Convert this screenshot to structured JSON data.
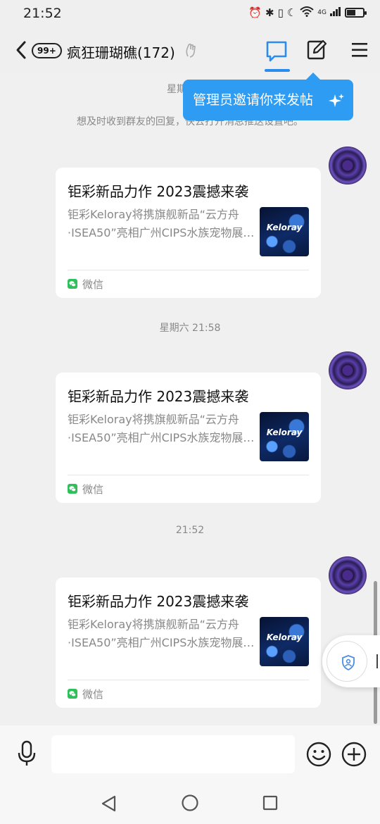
{
  "status_bar": {
    "time": "21:52",
    "network": "4G"
  },
  "header": {
    "unread_count": "99+",
    "group_title": "疯狂珊瑚礁(172)"
  },
  "tooltip": {
    "text": "管理员邀请你来发帖"
  },
  "system": {
    "note_start": "想及时收到群友的回复，快去打开消息推送设置吧。",
    "time1": "星期五",
    "time2": "星期六 21:58",
    "time3": "21:52"
  },
  "messages": [
    {
      "title": "钜彩新品力作 2023震撼来袭",
      "description": "钜彩Keloray将携旗舰新品“云方舟·ISEA50”亮相广州CIPS水族宠物展…",
      "thumb_label": "Keloray",
      "source": "微信"
    },
    {
      "title": "钜彩新品力作 2023震撼来袭",
      "description": "钜彩Keloray将携旗舰新品“云方舟·ISEA50”亮相广州CIPS水族宠物展…",
      "thumb_label": "Keloray",
      "source": "微信"
    },
    {
      "title": "钜彩新品力作 2023震撼来袭",
      "description": "钜彩Keloray将携旗舰新品“云方舟·ISEA50”亮相广州CIPS水族宠物展…",
      "thumb_label": "Keloray",
      "source": "微信"
    }
  ],
  "colors": {
    "accent": "#2a8cf0",
    "tooltip_bg": "#2d9cf2",
    "wechat_green": "#2fbf5b"
  }
}
